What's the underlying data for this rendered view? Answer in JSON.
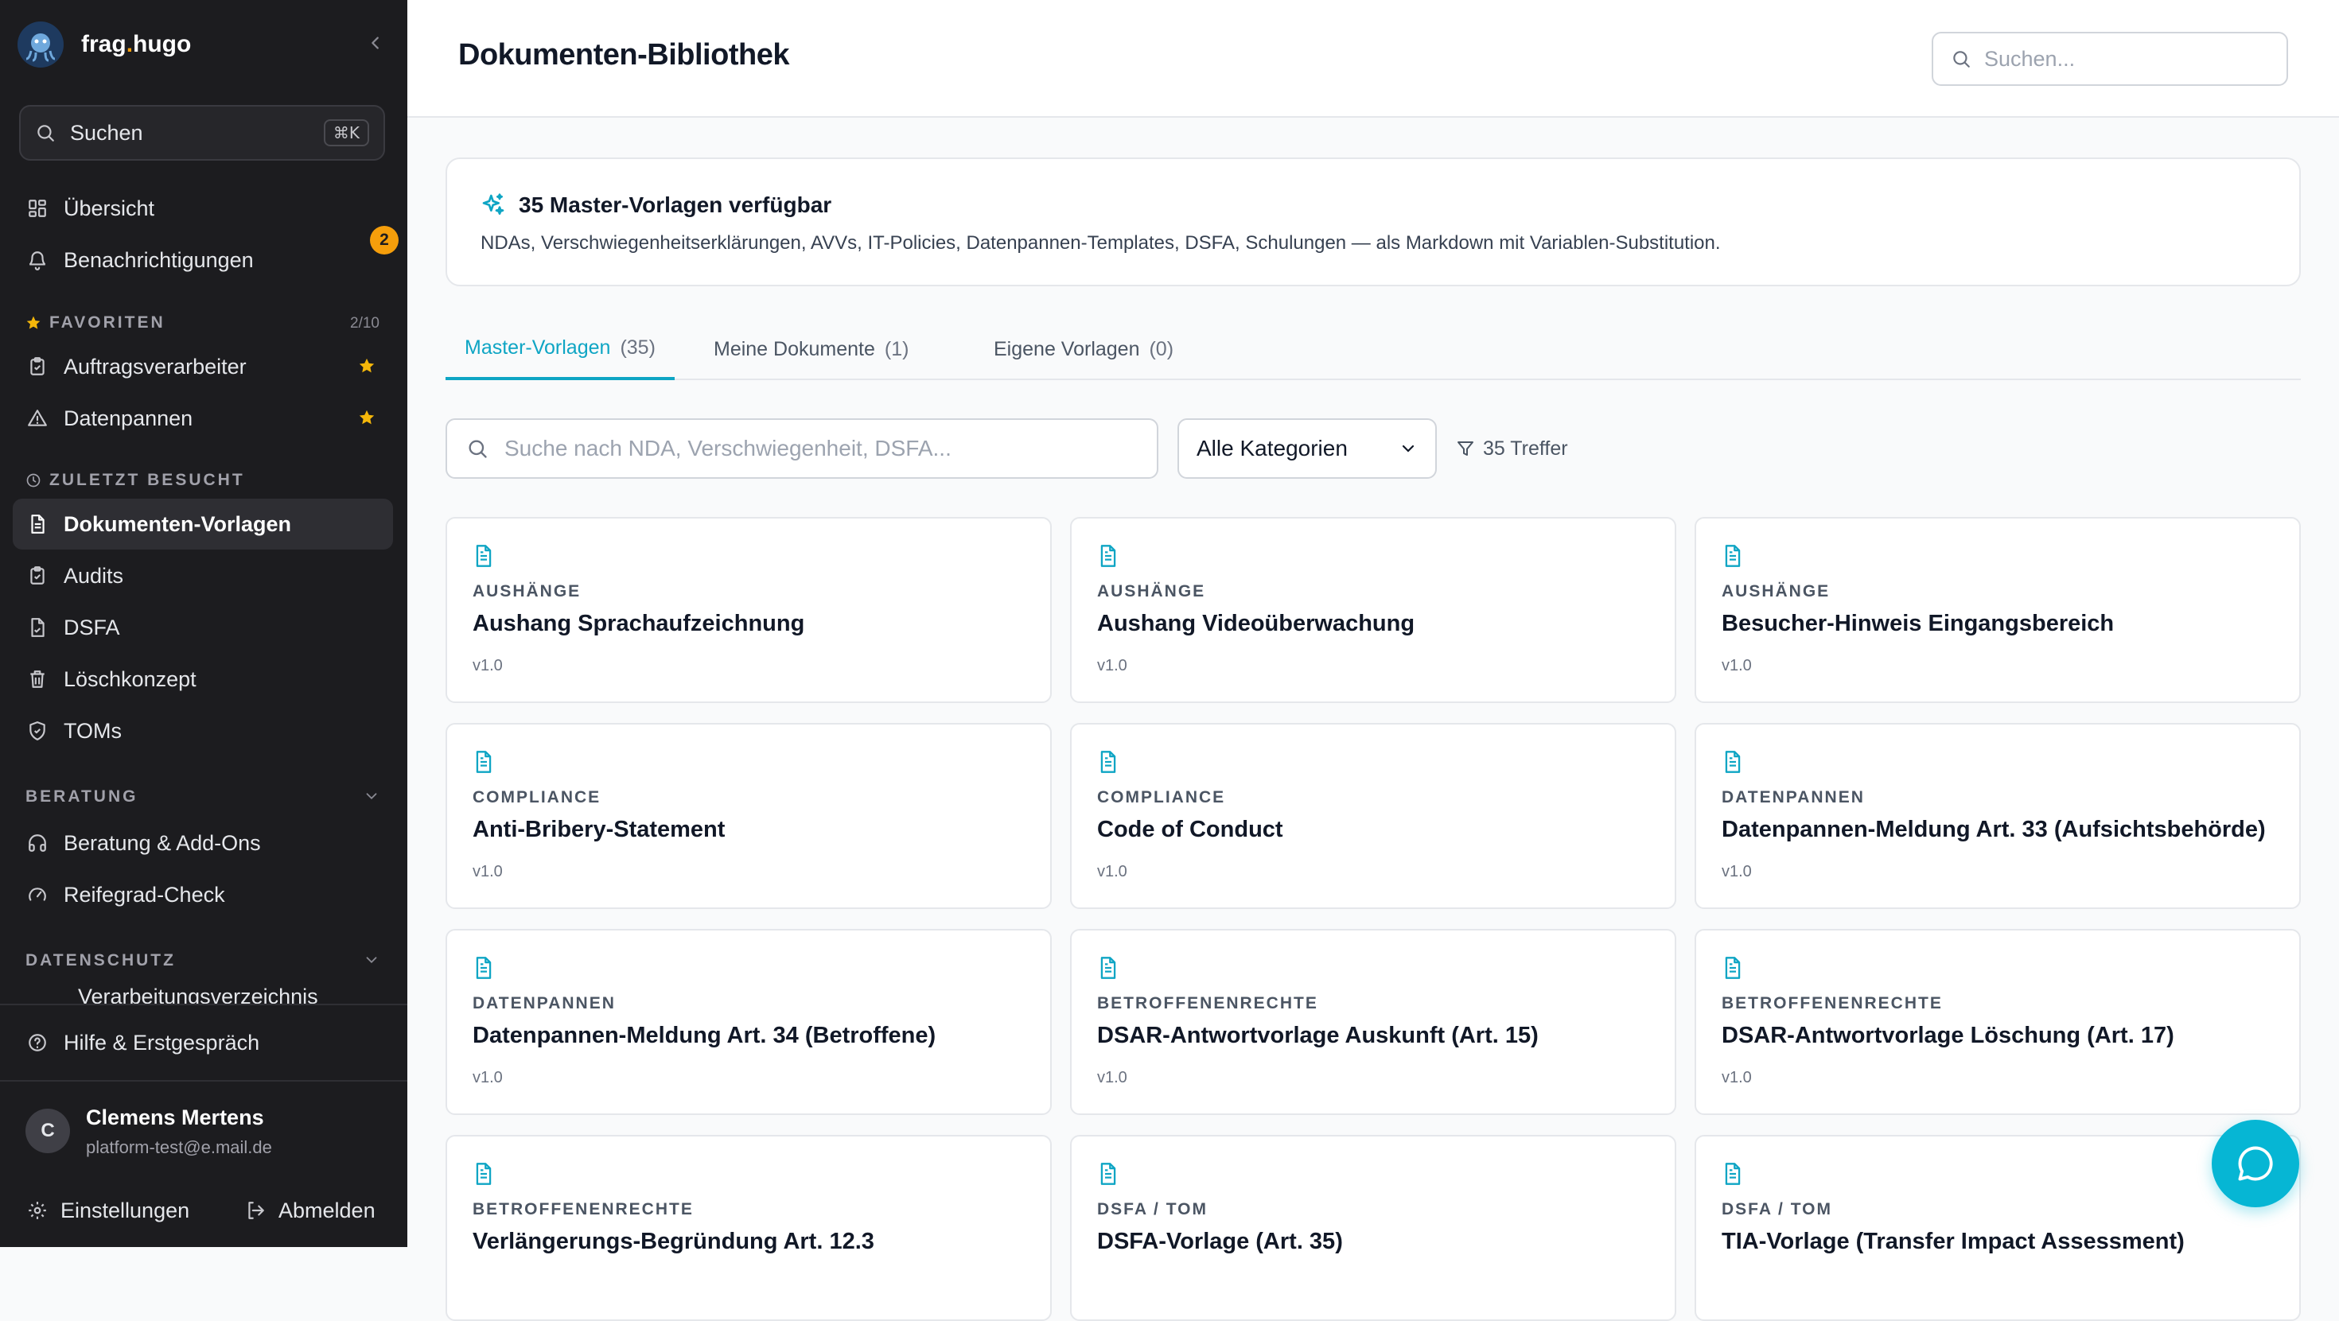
{
  "sidebar": {
    "brand": {
      "part1": "frag",
      "dot": ".",
      "part2": "hugo"
    },
    "search": {
      "label": "Suchen",
      "shortcut": "⌘K"
    },
    "nav_top": [
      {
        "label": "Übersicht",
        "icon": "dashboard-icon"
      },
      {
        "label": "Benachrichtigungen",
        "icon": "bell-icon",
        "badge": "2"
      }
    ],
    "favorites": {
      "title": "FAVORITEN",
      "count": "2/10",
      "items": [
        {
          "label": "Auftragsverarbeiter",
          "icon": "clipboard-icon"
        },
        {
          "label": "Datenpannen",
          "icon": "warning-icon"
        }
      ]
    },
    "recent": {
      "title": "ZULETZT BESUCHT",
      "items": [
        {
          "label": "Dokumenten-Vorlagen",
          "icon": "document-icon",
          "active": true
        },
        {
          "label": "Audits",
          "icon": "clipboard-check-icon"
        },
        {
          "label": "DSFA",
          "icon": "file-check-icon"
        },
        {
          "label": "Löschkonzept",
          "icon": "trash-icon"
        },
        {
          "label": "TOMs",
          "icon": "shield-check-icon"
        }
      ]
    },
    "beratung": {
      "title": "BERATUNG",
      "items": [
        {
          "label": "Beratung & Add-Ons",
          "icon": "headphones-icon"
        },
        {
          "label": "Reifegrad-Check",
          "icon": "gauge-icon"
        }
      ]
    },
    "datenschutz": {
      "title": "DATENSCHUTZ",
      "partial_item": "Verarbeitungsverzeichnis"
    },
    "help": {
      "label": "Hilfe & Erstgespräch"
    },
    "user": {
      "initial": "C",
      "name": "Clemens Mertens",
      "email": "platform-test@e.mail.de"
    },
    "settings_label": "Einstellungen",
    "logout_label": "Abmelden"
  },
  "header": {
    "title": "Dokumenten-Bibliothek",
    "search_placeholder": "Suchen..."
  },
  "info": {
    "title": "35 Master-Vorlagen verfügbar",
    "description": "NDAs, Verschwiegenheitserklärungen, AVVs, IT-Policies, Datenpannen-Templates, DSFA, Schulungen — als Markdown mit Variablen-Substitution."
  },
  "tabs": [
    {
      "label": "Master-Vorlagen",
      "count": "(35)",
      "active": true
    },
    {
      "label": "Meine Dokumente",
      "count": "(1)"
    },
    {
      "label": "Eigene Vorlagen",
      "count": "(0)"
    }
  ],
  "filters": {
    "search_placeholder": "Suche nach NDA, Verschwiegenheit, DSFA...",
    "category": "Alle Kategorien",
    "hits": "35 Treffer"
  },
  "cards": [
    {
      "category": "AUSHÄNGE",
      "title": "Aushang Sprachaufzeichnung",
      "version": "v1.0"
    },
    {
      "category": "AUSHÄNGE",
      "title": "Aushang Videoüberwachung",
      "version": "v1.0"
    },
    {
      "category": "AUSHÄNGE",
      "title": "Besucher-Hinweis Eingangsbereich",
      "version": "v1.0"
    },
    {
      "category": "COMPLIANCE",
      "title": "Anti-Bribery-Statement",
      "version": "v1.0"
    },
    {
      "category": "COMPLIANCE",
      "title": "Code of Conduct",
      "version": "v1.0"
    },
    {
      "category": "DATENPANNEN",
      "title": "Datenpannen-Meldung Art. 33 (Aufsichtsbehörde)",
      "version": "v1.0"
    },
    {
      "category": "DATENPANNEN",
      "title": "Datenpannen-Meldung Art. 34 (Betroffene)",
      "version": "v1.0"
    },
    {
      "category": "BETROFFENENRECHTE",
      "title": "DSAR-Antwortvorlage Auskunft (Art. 15)",
      "version": "v1.0"
    },
    {
      "category": "BETROFFENENRECHTE",
      "title": "DSAR-Antwortvorlage Löschung (Art. 17)",
      "version": "v1.0"
    },
    {
      "category": "BETROFFENENRECHTE",
      "title": "Verlängerungs-Begründung Art. 12.3",
      "version": ""
    },
    {
      "category": "DSFA / TOM",
      "title": "DSFA-Vorlage (Art. 35)",
      "version": ""
    },
    {
      "category": "DSFA / TOM",
      "title": "TIA-Vorlage (Transfer Impact Assessment)",
      "version": ""
    }
  ],
  "colors": {
    "accent": "#0ea5c4",
    "sidebar_bg": "#1c1c1f",
    "favorite_star": "#f5b70a",
    "badge": "#f59e0b"
  }
}
